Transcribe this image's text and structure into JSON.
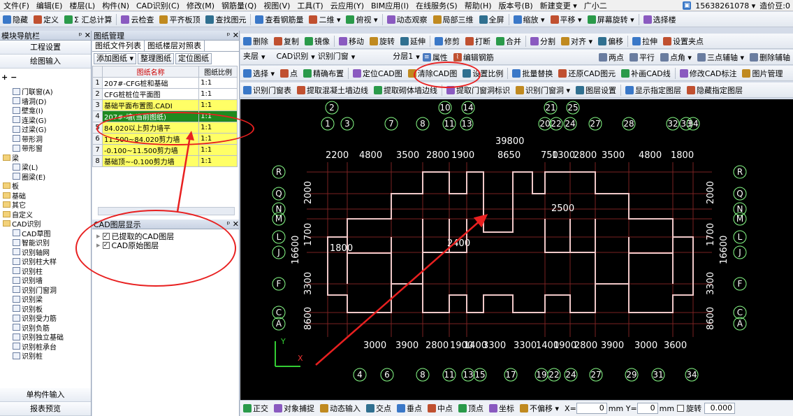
{
  "menubar": {
    "items": [
      "文件(F)",
      "编辑(E)",
      "楼层(L)",
      "构件(N)",
      "CAD识别(C)",
      "修改(M)",
      "钢筋量(Q)",
      "视图(V)",
      "工具(T)",
      "云应用(Y)",
      "BIM应用(I)",
      "在线服务(S)",
      "帮助(H)",
      "版本号(B)",
      "新建变更 ▾",
      "广小二"
    ],
    "account": "15638261078 ▾",
    "coins": "造价豆:0"
  },
  "toolbar1": [
    "隐藏",
    "定义",
    "Σ 汇总计算",
    "云检查",
    "平齐板顶",
    "查找图元",
    "查看钢筋量",
    "二维 ▾",
    "俯视 ▾",
    "动态观察",
    "局部三维",
    "全屏",
    "缩放 ▾",
    "平移 ▾",
    "屏幕旋转 ▾",
    "选择楼"
  ],
  "toolbar2": [
    "删除",
    "复制",
    "镜像",
    "移动",
    "旋转",
    "延伸",
    "修剪",
    "打断",
    "合并",
    "分割",
    "对齐 ▾",
    "偏移",
    "拉伸",
    "设置夹点"
  ],
  "toolbar3": {
    "floor": "夹层",
    "cad_id": "CAD识别",
    "id_door": "识别门窗",
    "layer": "分层1",
    "props": "属性",
    "edit_rebar": "编辑钢筋",
    "right": [
      "两点",
      "平行",
      "点角 ▾",
      "三点辅轴 ▾",
      "删除辅轴"
    ]
  },
  "toolbar4": [
    "选择 ▾",
    "点",
    "精确布置",
    "定位CAD图",
    "清除CAD图",
    "设置比例",
    "批量替换",
    "还原CAD图元",
    "补画CAD线",
    "修改CAD标注",
    "图片管理"
  ],
  "toolbar5": [
    "识别门窗表",
    "提取混凝土墙边线",
    "提取砌体墙边线",
    "提取门窗洞标识",
    "识别门窗洞 ▾",
    "图层设置",
    "显示指定图层",
    "隐藏指定图层"
  ],
  "nav": {
    "title": "模块导航栏",
    "btn1": "工程设置",
    "btn2": "绘图输入",
    "tree": [
      {
        "label": "门联窗(A)",
        "indent": 2,
        "icon": "t"
      },
      {
        "label": "墙洞(D)",
        "indent": 2,
        "icon": "t"
      },
      {
        "label": "壁龛(I)",
        "indent": 2,
        "icon": "t"
      },
      {
        "label": "连梁(G)",
        "indent": 2,
        "icon": "t"
      },
      {
        "label": "过梁(G)",
        "indent": 2,
        "icon": "t"
      },
      {
        "label": "带形洞",
        "indent": 2,
        "icon": "t"
      },
      {
        "label": "带形窗",
        "indent": 2,
        "icon": "t"
      },
      {
        "label": "梁",
        "indent": 0,
        "icon": "f"
      },
      {
        "label": "梁(L)",
        "indent": 2,
        "icon": "t"
      },
      {
        "label": "圈梁(E)",
        "indent": 2,
        "icon": "t"
      },
      {
        "label": "板",
        "indent": 0,
        "icon": "f"
      },
      {
        "label": "基础",
        "indent": 0,
        "icon": "f"
      },
      {
        "label": "其它",
        "indent": 0,
        "icon": "f"
      },
      {
        "label": "自定义",
        "indent": 0,
        "icon": "f"
      },
      {
        "label": "CAD识别",
        "indent": 0,
        "icon": "f"
      },
      {
        "label": "CAD草图",
        "indent": 2,
        "icon": "t"
      },
      {
        "label": "智能识别",
        "indent": 2,
        "icon": "t"
      },
      {
        "label": "识别轴网",
        "indent": 2,
        "icon": "t"
      },
      {
        "label": "识别柱大样",
        "indent": 2,
        "icon": "t"
      },
      {
        "label": "识别柱",
        "indent": 2,
        "icon": "t"
      },
      {
        "label": "识别墙",
        "indent": 2,
        "icon": "t"
      },
      {
        "label": "识别门窗洞",
        "indent": 2,
        "icon": "t"
      },
      {
        "label": "识别梁",
        "indent": 2,
        "icon": "t"
      },
      {
        "label": "识别板",
        "indent": 2,
        "icon": "t"
      },
      {
        "label": "识别受力筋",
        "indent": 2,
        "icon": "t"
      },
      {
        "label": "识别负筋",
        "indent": 2,
        "icon": "t"
      },
      {
        "label": "识别独立基础",
        "indent": 2,
        "icon": "t"
      },
      {
        "label": "识别桩承台",
        "indent": 2,
        "icon": "t"
      },
      {
        "label": "识别桩",
        "indent": 2,
        "icon": "t"
      }
    ],
    "bottom1": "单构件输入",
    "bottom2": "报表预览"
  },
  "drawing": {
    "title": "图纸管理",
    "tab1": "图纸文件列表",
    "tab2": "图纸楼层对照表",
    "btn_add": "添加图纸 ▾",
    "btn_org": "整理图纸",
    "btn_locate": "定位图纸",
    "col_name": "图纸名称",
    "col_ratio": "图纸比例",
    "rows": [
      {
        "idx": "1",
        "name": "207#-CFG桩和基础",
        "ratio": "1:1",
        "bg": "#ffffff"
      },
      {
        "idx": "2",
        "name": "CFG桩桩位平面图",
        "ratio": "1:1",
        "bg": "#ffffff"
      },
      {
        "idx": "3",
        "name": "基础平面布置图.CADI",
        "ratio": "1:1",
        "bg": "#ffff66"
      },
      {
        "idx": "4",
        "name": "207#-墙(当前图纸)",
        "ratio": "1:1",
        "bg": "#1f8a1f"
      },
      {
        "idx": "5",
        "name": "84.020以上剪力墙平",
        "ratio": "1:1",
        "bg": "#ffff66"
      },
      {
        "idx": "6",
        "name": "11.500~84.020剪力墙",
        "ratio": "1:1",
        "bg": "#ffff66"
      },
      {
        "idx": "7",
        "name": "-0.100~11.500剪力墙",
        "ratio": "1:1",
        "bg": "#ffff66"
      },
      {
        "idx": "8",
        "name": "基础顶~-0.100剪力墙",
        "ratio": "1:1",
        "bg": "#ffff66"
      }
    ]
  },
  "layer": {
    "title": "CAD图层显示",
    "item1": "已提取的CAD图层",
    "item2": "CAD原始图层"
  },
  "cad": {
    "top_axes": [
      "2",
      "1",
      "3",
      "7",
      "8",
      "10",
      "14",
      "11",
      "13",
      "21",
      "25",
      "20",
      "22",
      "24",
      "27",
      "28",
      "32",
      "33",
      "34"
    ],
    "bottom_axes": [
      "4",
      "6",
      "8",
      "11",
      "13",
      "15",
      "17",
      "19",
      "22",
      "24",
      "27",
      "29",
      "31",
      "34"
    ],
    "row_axes": [
      "R",
      "Q",
      "N",
      "M",
      "L",
      "J",
      "F",
      "C",
      "A"
    ],
    "total_dim": "39800",
    "top_dims": [
      "2200",
      "4800",
      "3500",
      "2800",
      "1900",
      "8650",
      "750",
      "1300",
      "2800",
      "3500",
      "4800",
      "1800"
    ],
    "bottom_dims": [
      "3000",
      "3900",
      "2800",
      "1900",
      "1400",
      "3300",
      "3300",
      "1400",
      "1900",
      "2800",
      "3900",
      "3000",
      "3600"
    ],
    "side_dims": [
      "16600",
      "3300",
      "8600",
      "1700",
      "2000"
    ],
    "inner_dims": [
      "2500",
      "1800",
      "2400"
    ],
    "ucs_y": "Y",
    "ucs_x": "X"
  },
  "status": {
    "items": [
      "正交",
      "对象捕捉",
      "动态输入",
      "交点",
      "垂点",
      "中点",
      "顶点",
      "坐标",
      "不偏移 ▾"
    ],
    "x_label": "X=",
    "x_val": "0",
    "y_label": "mm Y=",
    "y_val": "0",
    "unit": "mm",
    "rotate_label": "旋转",
    "rotate_val": "0.000"
  }
}
